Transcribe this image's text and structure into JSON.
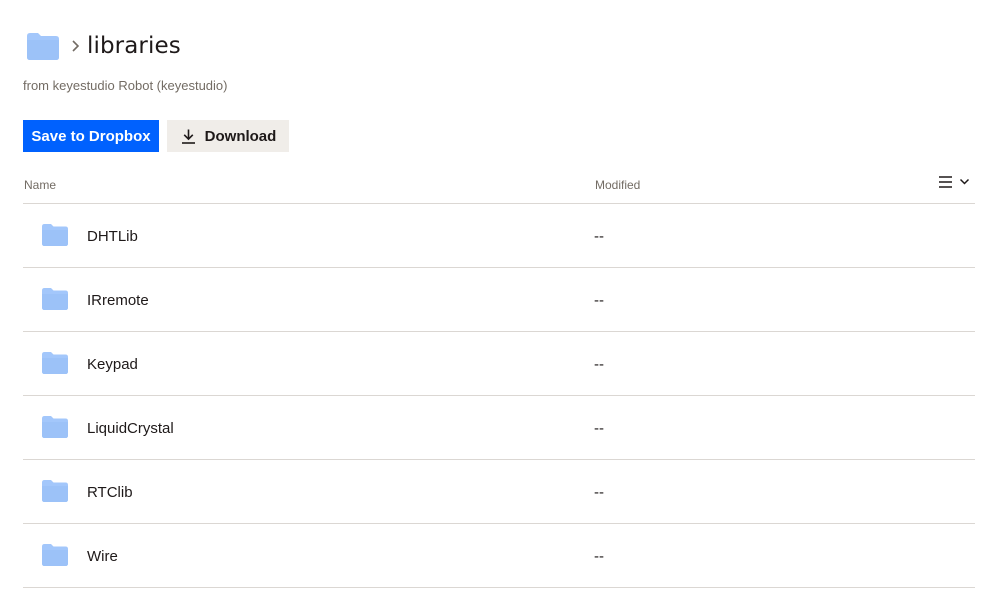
{
  "header": {
    "title": "libraries",
    "subtitle": "from keyestudio Robot (keyestudio)",
    "folder_color": "#a3c7fb"
  },
  "actions": {
    "save_label": "Save to Dropbox",
    "download_label": "Download",
    "primary_color": "#0061fe"
  },
  "table": {
    "columns": {
      "name": "Name",
      "modified": "Modified"
    },
    "view_toggle_icon": "list-view-icon",
    "rows": [
      {
        "name": "DHTLib",
        "modified": "--",
        "icon": "folder-icon"
      },
      {
        "name": "IRremote",
        "modified": "--",
        "icon": "folder-icon"
      },
      {
        "name": "Keypad",
        "modified": "--",
        "icon": "folder-icon"
      },
      {
        "name": "LiquidCrystal",
        "modified": "--",
        "icon": "folder-icon"
      },
      {
        "name": "RTClib",
        "modified": "--",
        "icon": "folder-icon"
      },
      {
        "name": "Wire",
        "modified": "--",
        "icon": "folder-icon"
      }
    ]
  }
}
